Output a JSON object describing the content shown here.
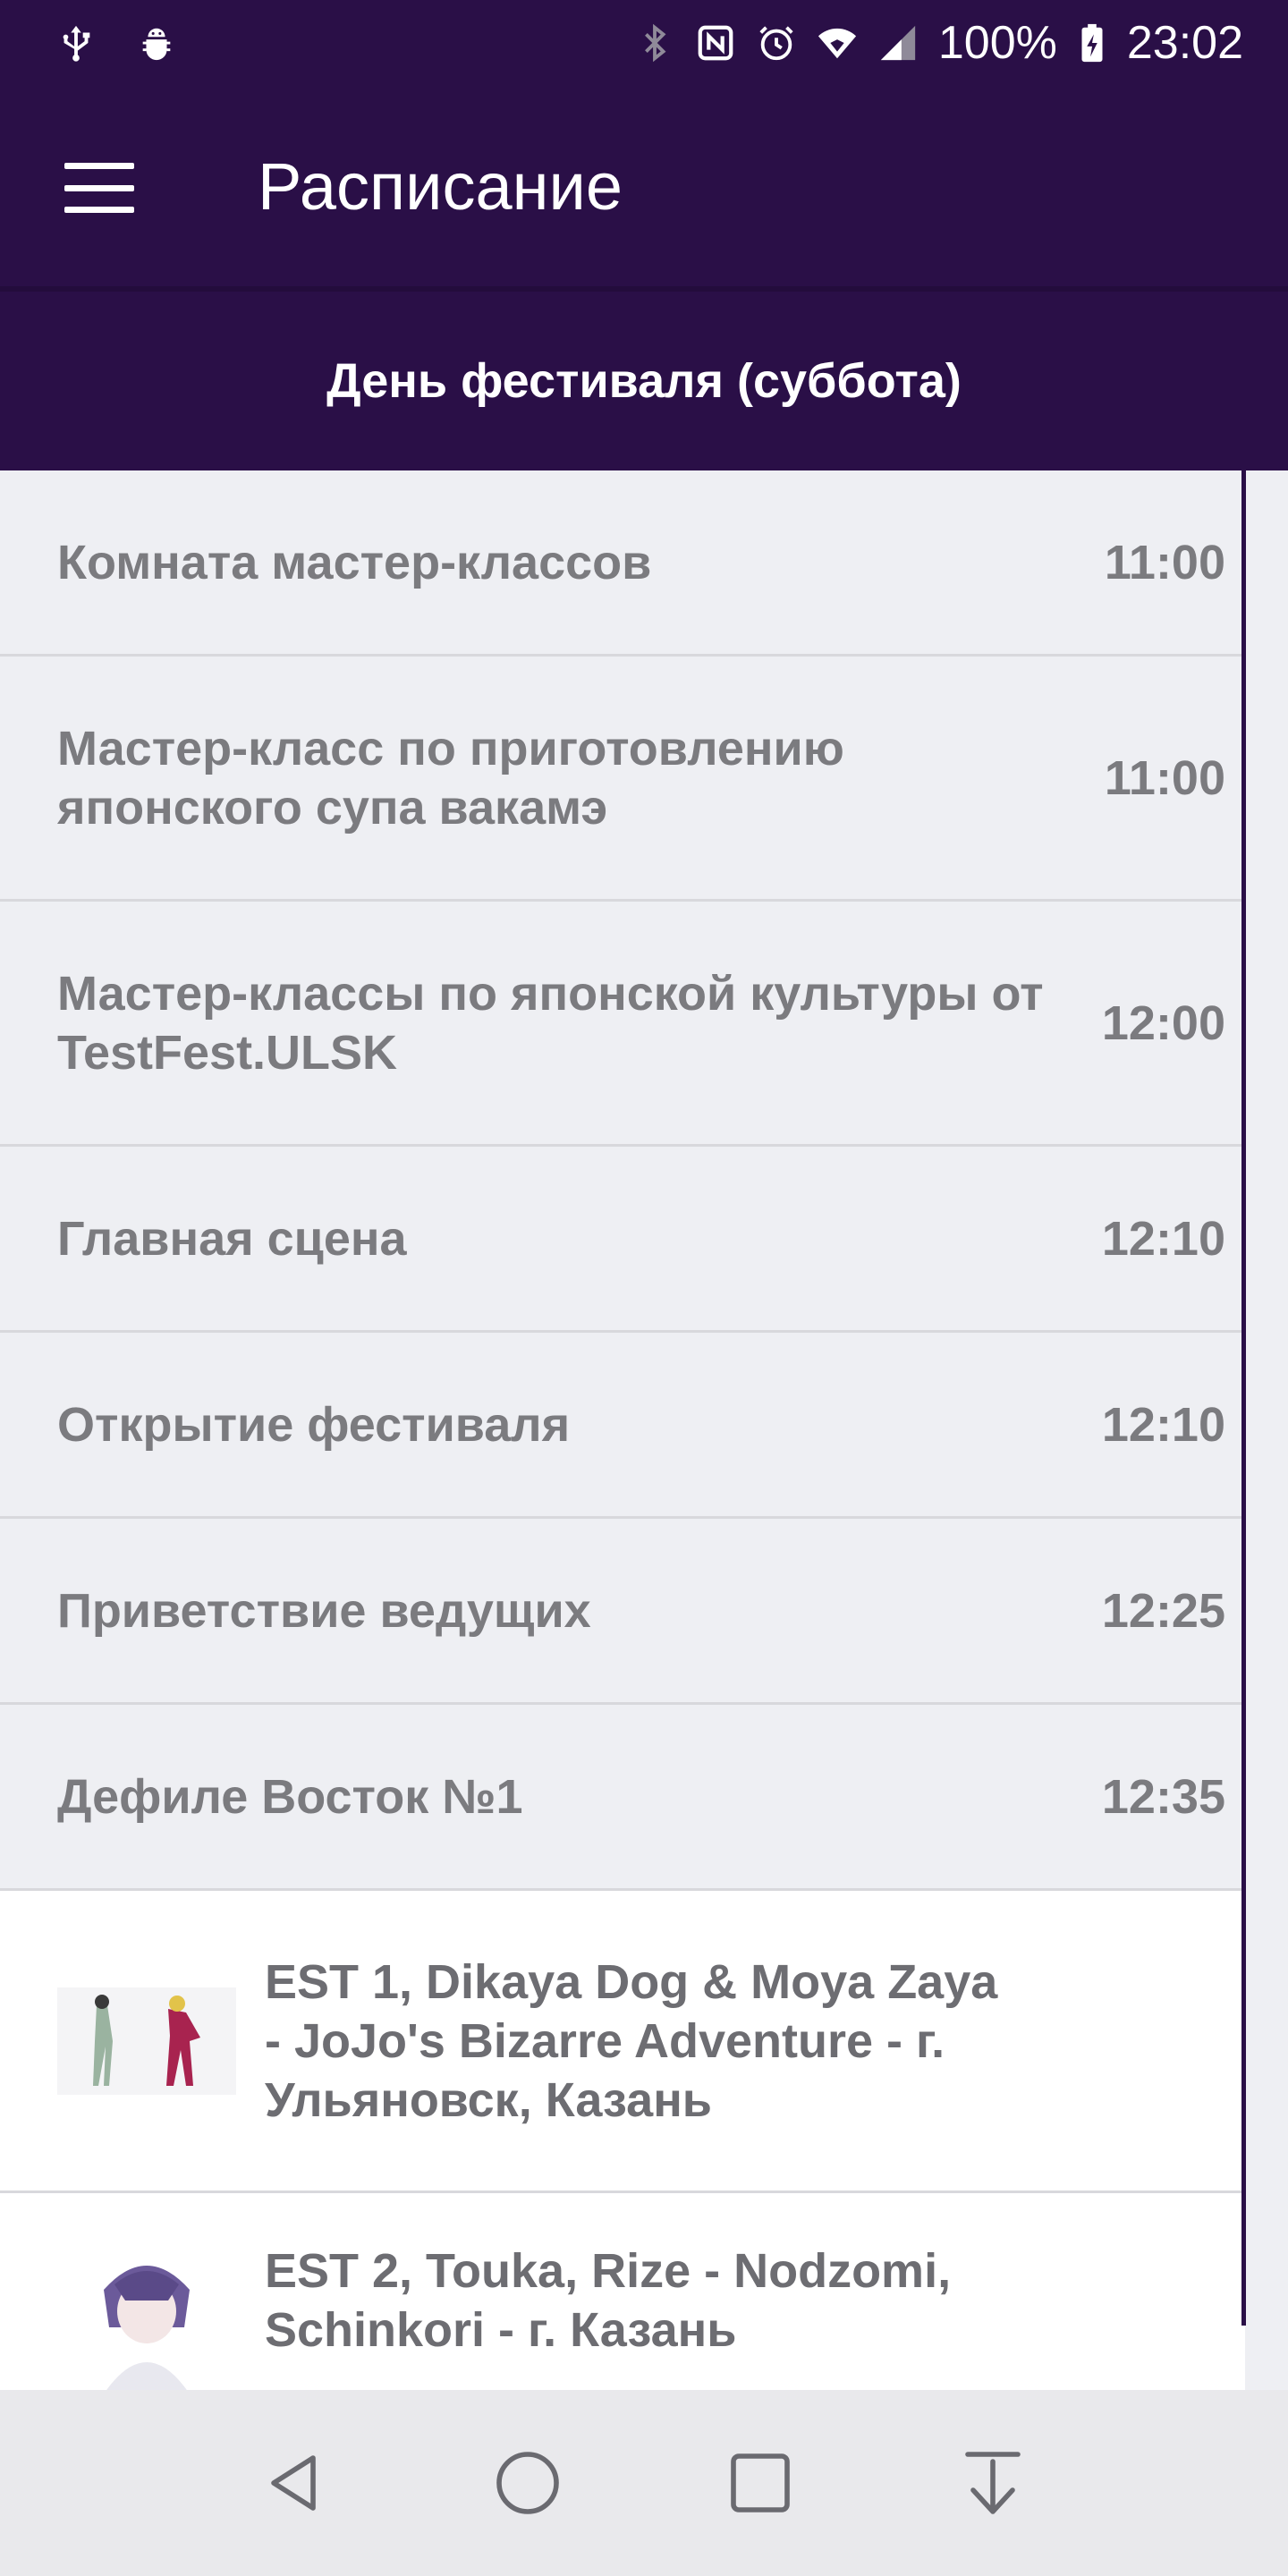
{
  "status_bar": {
    "battery": "100%",
    "time": "23:02"
  },
  "app_bar": {
    "title": "Расписание"
  },
  "day_header": {
    "label": "День фестиваля (суббота)"
  },
  "schedule": [
    {
      "name": "Комната мастер-классов",
      "time": "11:00"
    },
    {
      "name": "Мастер-класс по приготовлению японского супа вакамэ",
      "time": "11:00"
    },
    {
      "name": "Мастер-классы по японской культуры от TestFest.ULSK",
      "time": "12:00"
    },
    {
      "name": "Главная сцена",
      "time": "12:10"
    },
    {
      "name": "Открытие фестиваля",
      "time": "12:10"
    },
    {
      "name": "Приветствие ведущих",
      "time": "12:25"
    },
    {
      "name": "Дефиле Восток №1",
      "time": "12:35"
    }
  ],
  "participants": [
    {
      "name": "EST 1, Dikaya Dog & Moya Zaya - JoJo's Bizarre Adventure - г. Ульяновск,  Казань"
    },
    {
      "name": "EST 2, Touka, Rize - Nodzomi, Schinkori - г. Казань"
    }
  ],
  "colors": {
    "primary": "#2a0f47",
    "list_bg": "#eeeff3",
    "text": "#7b7b7f",
    "nav_bg": "#e9e9ec"
  }
}
